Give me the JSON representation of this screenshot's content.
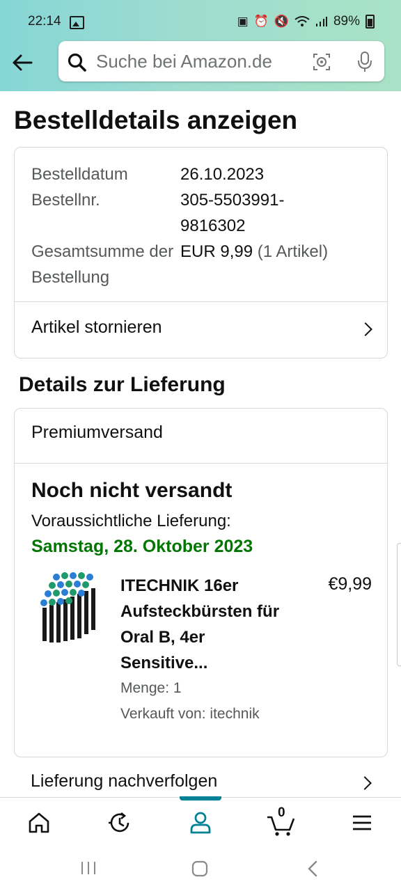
{
  "status_bar": {
    "time": "22:14",
    "battery": "89%",
    "icons": [
      "gallery-icon",
      "lock-icon",
      "alarm-icon",
      "mute-icon",
      "wifi-icon",
      "signal-icon",
      "battery-icon"
    ]
  },
  "search": {
    "placeholder": "Suche bei Amazon.de"
  },
  "page": {
    "title": "Bestelldetails anzeigen"
  },
  "order": {
    "date_label": "Bestelldatum",
    "date": "26.10.2023",
    "number_label": "Bestellnr.",
    "number": "305-5503991-9816302",
    "total_label": "Gesamtsumme der Bestellung",
    "total": "EUR 9,99",
    "total_items": "(1 Artikel)",
    "cancel_label": "Artikel stornieren"
  },
  "delivery": {
    "heading": "Details zur Lieferung",
    "method": "Premiumversand",
    "status": "Noch nicht versandt",
    "eta_label": "Voraussichtliche Lieferung:",
    "eta_date": "Samstag, 28. Oktober 2023",
    "item": {
      "name": "ITECHNIK 16er Aufsteckbürsten für Oral B, 4er Sensitive...",
      "price": "€9,99",
      "quantity": "Menge: 1",
      "seller": "Verkauft von: itechnik"
    },
    "track_label": "Lieferung nachverfolgen"
  },
  "bottom_nav": {
    "cart_count": "0",
    "active": "account",
    "items": [
      "home-icon",
      "returns-icon",
      "account-icon",
      "cart-icon",
      "menu-icon"
    ]
  },
  "colors": {
    "accent": "#008296",
    "eta_green": "#007600",
    "header_start": "#86d6d6",
    "header_end": "#a9e2c6"
  }
}
